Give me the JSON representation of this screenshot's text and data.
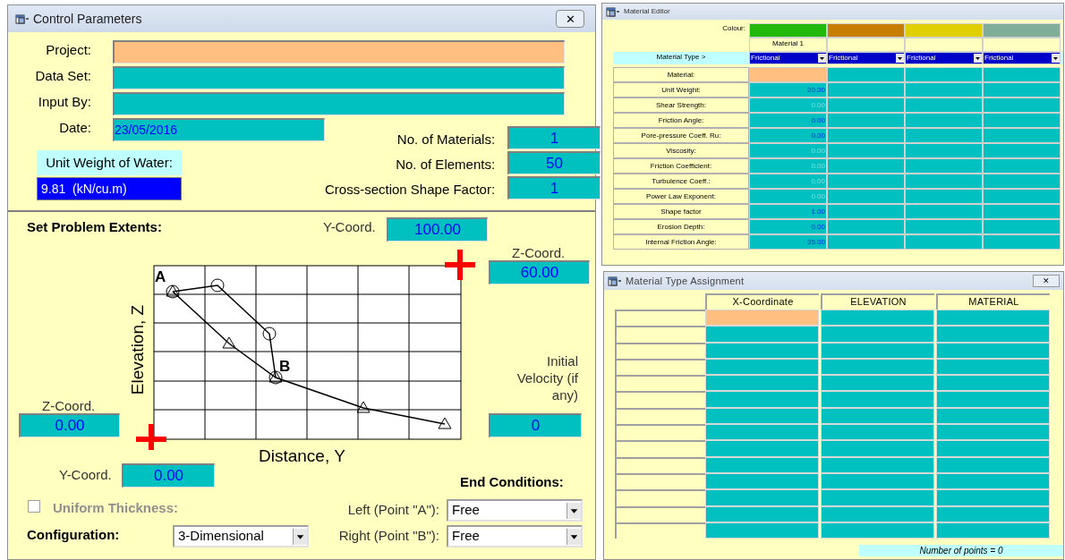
{
  "control_parameters": {
    "title": "Control Parameters",
    "close": "✕",
    "fields": [
      {
        "label": "Project:",
        "selected": true
      },
      {
        "label": "Data Set:",
        "selected": false
      },
      {
        "label": "Input By:",
        "selected": false
      }
    ],
    "date": {
      "label": "Date:",
      "value": "23/05/2016"
    },
    "unit_weight": {
      "label": "Unit Weight of Water:",
      "value": "9.81  (kN/cu.m)"
    },
    "counts": [
      {
        "label": "No. of Materials:",
        "value": "1"
      },
      {
        "label": "No. of Elements:",
        "value": "50"
      },
      {
        "label": "Cross-section Shape Factor:",
        "value": "1"
      }
    ],
    "extents": {
      "heading": "Set Problem Extents:",
      "y_top": {
        "label": "Y-Coord.",
        "value": "100.00"
      },
      "z_top": {
        "label": "Z-Coord.",
        "value": "60.00"
      },
      "z_bottom": {
        "label": "Z-Coord.",
        "value": "0.00"
      },
      "y_bottom": {
        "label": "Y-Coord.",
        "value": "0.00"
      },
      "initial_velocity": {
        "label": "Initial Velocity (if any)",
        "value": "0"
      },
      "diagram": {
        "point_a": "A",
        "point_b": "B",
        "xlabel": "Distance, Y",
        "ylabel": "Elevation, Z"
      }
    },
    "uniform_thickness": {
      "label": "Uniform Thickness:",
      "checked": false,
      "disabled": true
    },
    "configuration": {
      "label": "Configuration:",
      "value": "3-Dimensional"
    },
    "end_conditions": {
      "heading": "End Conditions:",
      "items": [
        {
          "label": "Left (Point \"A\"):",
          "value": "Free"
        },
        {
          "label": "Right (Point \"B\"):",
          "value": "Free"
        }
      ]
    }
  },
  "material_editor": {
    "title": "Material Editor",
    "colour_label": "Colour:",
    "type_label": "Material Type >",
    "materials": [
      {
        "color": "#22b80c",
        "name": "Material  1",
        "type": "Frictional"
      },
      {
        "color": "#c87e00",
        "type": "Frictional"
      },
      {
        "color": "#e0d000",
        "type": "Frictional"
      },
      {
        "color": "#7fae98",
        "type": "Frictional"
      }
    ],
    "rows": [
      {
        "label": "Material:",
        "dimmed": false,
        "cells": [
          {
            "selected": true
          },
          {
            "selected": false
          },
          {
            "selected": false
          },
          {
            "selected": false
          }
        ]
      },
      {
        "label": "Unit Weight:",
        "dimmed": false,
        "cells": [
          {
            "value": "20.00",
            "selected": false
          },
          {
            "selected": false
          },
          {
            "selected": false
          },
          {
            "selected": false
          }
        ]
      },
      {
        "label": "Shear Strength:",
        "dimmed": true,
        "cells": [
          {
            "value": "0.00",
            "selected": false
          },
          {
            "selected": false
          },
          {
            "selected": false
          },
          {
            "selected": false
          }
        ]
      },
      {
        "label": "Friction Angle:",
        "dimmed": false,
        "cells": [
          {
            "value": "0.00",
            "selected": false
          },
          {
            "selected": false
          },
          {
            "selected": false
          },
          {
            "selected": false
          }
        ]
      },
      {
        "label": "Pore-pressure Coeff. Ru:",
        "dimmed": false,
        "cells": [
          {
            "value": "0.00",
            "selected": false
          },
          {
            "selected": false
          },
          {
            "selected": false
          },
          {
            "selected": false
          }
        ]
      },
      {
        "label": "Viscosity:",
        "dimmed": true,
        "cells": [
          {
            "value": "0.00",
            "selected": false
          },
          {
            "selected": false
          },
          {
            "selected": false
          },
          {
            "selected": false
          }
        ]
      },
      {
        "label": "Friction Coefficient:",
        "dimmed": true,
        "cells": [
          {
            "value": "0.00",
            "selected": false
          },
          {
            "selected": false
          },
          {
            "selected": false
          },
          {
            "selected": false
          }
        ]
      },
      {
        "label": "Turbulence Coeff.:",
        "dimmed": true,
        "cells": [
          {
            "value": "0.00",
            "selected": false
          },
          {
            "selected": false
          },
          {
            "selected": false
          },
          {
            "selected": false
          }
        ]
      },
      {
        "label": "Power Law Exponent:",
        "dimmed": true,
        "cells": [
          {
            "value": "0.00",
            "selected": false
          },
          {
            "selected": false
          },
          {
            "selected": false
          },
          {
            "selected": false
          }
        ]
      },
      {
        "label": "Shape factor",
        "dimmed": false,
        "cells": [
          {
            "value": "1.00",
            "selected": false
          },
          {
            "selected": false
          },
          {
            "selected": false
          },
          {
            "selected": false
          }
        ]
      },
      {
        "label": "Erosion Depth:",
        "dimmed": false,
        "cells": [
          {
            "value": "0.00",
            "selected": false
          },
          {
            "selected": false
          },
          {
            "selected": false
          },
          {
            "selected": false
          }
        ]
      },
      {
        "label": "Internal Friction Angle:",
        "dimmed": false,
        "cells": [
          {
            "value": "35.00",
            "selected": false
          },
          {
            "selected": false
          },
          {
            "selected": false
          },
          {
            "selected": false
          }
        ]
      }
    ]
  },
  "material_type_assignment": {
    "title": "Material Type Assignment",
    "close": "✕",
    "columns": [
      "X-Coordinate",
      "ELEVATION",
      "MATERIAL"
    ],
    "rows": [
      {
        "cells": [
          {
            "selected": true
          },
          {
            "selected": false
          },
          {
            "selected": false
          }
        ]
      },
      {
        "cells": [
          {
            "selected": false
          },
          {
            "selected": false
          },
          {
            "selected": false
          }
        ]
      },
      {
        "cells": [
          {
            "selected": false
          },
          {
            "selected": false
          },
          {
            "selected": false
          }
        ]
      },
      {
        "cells": [
          {
            "selected": false
          },
          {
            "selected": false
          },
          {
            "selected": false
          }
        ]
      },
      {
        "cells": [
          {
            "selected": false
          },
          {
            "selected": false
          },
          {
            "selected": false
          }
        ]
      },
      {
        "cells": [
          {
            "selected": false
          },
          {
            "selected": false
          },
          {
            "selected": false
          }
        ]
      },
      {
        "cells": [
          {
            "selected": false
          },
          {
            "selected": false
          },
          {
            "selected": false
          }
        ]
      },
      {
        "cells": [
          {
            "selected": false
          },
          {
            "selected": false
          },
          {
            "selected": false
          }
        ]
      },
      {
        "cells": [
          {
            "selected": false
          },
          {
            "selected": false
          },
          {
            "selected": false
          }
        ]
      },
      {
        "cells": [
          {
            "selected": false
          },
          {
            "selected": false
          },
          {
            "selected": false
          }
        ]
      },
      {
        "cells": [
          {
            "selected": false
          },
          {
            "selected": false
          },
          {
            "selected": false
          }
        ]
      },
      {
        "cells": [
          {
            "selected": false
          },
          {
            "selected": false
          },
          {
            "selected": false
          }
        ]
      },
      {
        "cells": [
          {
            "selected": false
          },
          {
            "selected": false
          },
          {
            "selected": false
          }
        ]
      },
      {
        "cells": [
          {
            "selected": false
          },
          {
            "selected": false
          },
          {
            "selected": false
          }
        ]
      }
    ],
    "status": "Number of points = 0"
  }
}
